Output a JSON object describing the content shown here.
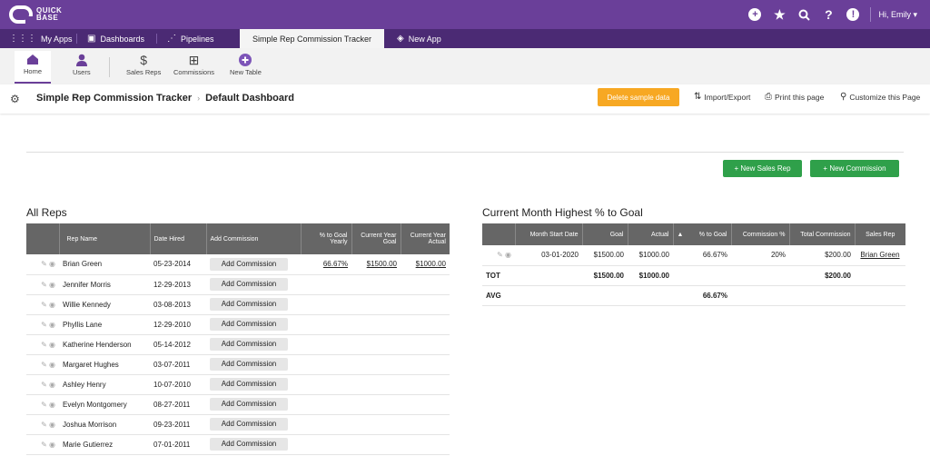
{
  "brand": {
    "line1": "QUICK",
    "line2": "BASE"
  },
  "topbar": {
    "icons": [
      "add-icon",
      "star-icon",
      "search-icon",
      "help-icon",
      "alert-icon"
    ],
    "user": "Hi, Emily"
  },
  "tabs": [
    {
      "label": "My Apps",
      "icon": "grid-icon"
    },
    {
      "label": "Dashboards",
      "icon": "dashboard-icon"
    },
    {
      "label": "Pipelines",
      "icon": "pipelines-icon"
    },
    {
      "label": "Simple Rep Commission Tracker",
      "icon": ""
    },
    {
      "label": "New App",
      "icon": "cube-icon"
    }
  ],
  "tables_nav": [
    {
      "label": "Home",
      "icon": "home-icon"
    },
    {
      "label": "Users",
      "icon": "users-icon"
    },
    {
      "label": "Sales Reps",
      "icon": "dollar-icon"
    },
    {
      "label": "Commissions",
      "icon": "commissions-icon"
    },
    {
      "label": "New Table",
      "icon": "plus-circle-icon"
    }
  ],
  "breadcrumb": {
    "app": "Simple Rep Commission Tracker",
    "page": "Default Dashboard"
  },
  "actions": {
    "delete_sample": "Delete sample data",
    "import_export": "Import/Export",
    "print": "Print this page",
    "customize": "Customize this Page"
  },
  "buttons": {
    "new_sales_rep": "+ New Sales Rep",
    "new_commission": "+ New Commission"
  },
  "all_reps": {
    "title": "All Reps",
    "columns": [
      "Rep Name",
      "Date Hired",
      "Add Commission",
      "% to Goal Yearly",
      "Current Year Goal",
      "Current Year Actual"
    ],
    "rows": [
      {
        "name": "Brian Green",
        "date": "05-23-2014",
        "add": "Add Commission",
        "pct": "66.67%",
        "goal": "$1500.00",
        "actual": "$1000.00"
      },
      {
        "name": "Jennifer Morris",
        "date": "12-29-2013",
        "add": "Add Commission",
        "pct": "",
        "goal": "",
        "actual": ""
      },
      {
        "name": "Willie Kennedy",
        "date": "03-08-2013",
        "add": "Add Commission",
        "pct": "",
        "goal": "",
        "actual": ""
      },
      {
        "name": "Phyllis Lane",
        "date": "12-29-2010",
        "add": "Add Commission",
        "pct": "",
        "goal": "",
        "actual": ""
      },
      {
        "name": "Katherine Henderson",
        "date": "05-14-2012",
        "add": "Add Commission",
        "pct": "",
        "goal": "",
        "actual": ""
      },
      {
        "name": "Margaret Hughes",
        "date": "03-07-2011",
        "add": "Add Commission",
        "pct": "",
        "goal": "",
        "actual": ""
      },
      {
        "name": "Ashley Henry",
        "date": "10-07-2010",
        "add": "Add Commission",
        "pct": "",
        "goal": "",
        "actual": ""
      },
      {
        "name": "Evelyn Montgomery",
        "date": "08-27-2011",
        "add": "Add Commission",
        "pct": "",
        "goal": "",
        "actual": ""
      },
      {
        "name": "Joshua Morrison",
        "date": "09-23-2011",
        "add": "Add Commission",
        "pct": "",
        "goal": "",
        "actual": ""
      },
      {
        "name": "Marie Gutierrez",
        "date": "07-01-2011",
        "add": "Add Commission",
        "pct": "",
        "goal": "",
        "actual": ""
      }
    ]
  },
  "highest": {
    "title": "Current Month Highest % to Goal",
    "columns": [
      "Month Start Date",
      "Goal",
      "Actual",
      "% to Goal",
      "Commission %",
      "Total Commission",
      "Sales Rep"
    ],
    "sort_indicator": "▲",
    "row": {
      "date": "03-01-2020",
      "goal": "$1500.00",
      "actual": "$1000.00",
      "pct": "66.67%",
      "comm": "20%",
      "total": "$200.00",
      "rep": "Brian Green"
    },
    "tot": {
      "label": "TOT",
      "goal": "$1500.00",
      "actual": "$1000.00",
      "total": "$200.00"
    },
    "avg": {
      "label": "AVG",
      "pct": "66.67%"
    }
  },
  "colors": {
    "purple": "#6a3f99",
    "dark_purple": "#4b2a74",
    "orange": "#f7a823",
    "green": "#2fa04a",
    "header_gray": "#666666"
  }
}
